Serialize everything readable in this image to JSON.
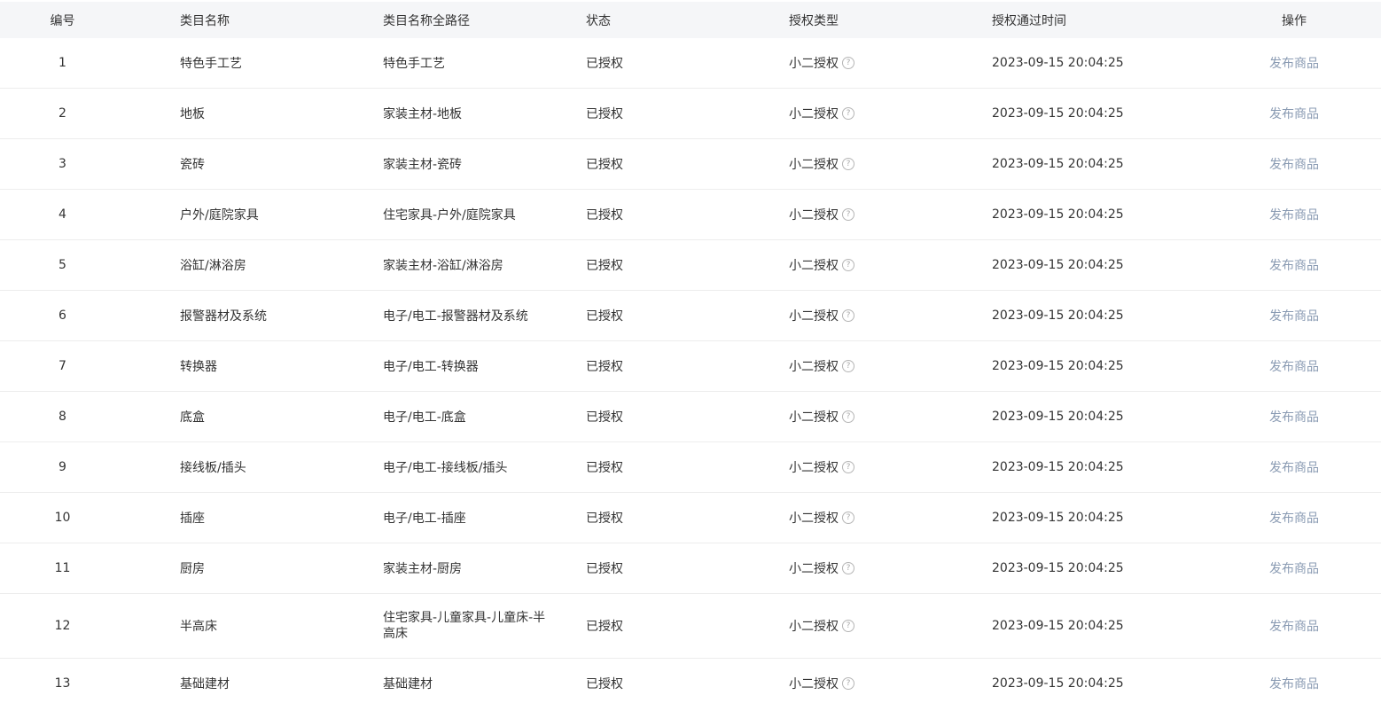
{
  "headers": {
    "id": "编号",
    "name": "类目名称",
    "path": "类目名称全路径",
    "status": "状态",
    "auth_type": "授权类型",
    "auth_time": "授权通过时间",
    "action": "操作"
  },
  "help_icon_glyph": "?",
  "colors": {
    "header_bg": "#f5f6f8",
    "link": "#8a9bb3",
    "divider": "#ededed"
  },
  "rows": [
    {
      "id": "1",
      "name": "特色手工艺",
      "path": "特色手工艺",
      "status": "已授权",
      "auth_type": "小二授权",
      "auth_time": "2023-09-15 20:04:25",
      "action": "发布商品"
    },
    {
      "id": "2",
      "name": "地板",
      "path": "家装主材-地板",
      "status": "已授权",
      "auth_type": "小二授权",
      "auth_time": "2023-09-15 20:04:25",
      "action": "发布商品"
    },
    {
      "id": "3",
      "name": "瓷砖",
      "path": "家装主材-瓷砖",
      "status": "已授权",
      "auth_type": "小二授权",
      "auth_time": "2023-09-15 20:04:25",
      "action": "发布商品"
    },
    {
      "id": "4",
      "name": "户外/庭院家具",
      "path": "住宅家具-户外/庭院家具",
      "status": "已授权",
      "auth_type": "小二授权",
      "auth_time": "2023-09-15 20:04:25",
      "action": "发布商品"
    },
    {
      "id": "5",
      "name": "浴缸/淋浴房",
      "path": "家装主材-浴缸/淋浴房",
      "status": "已授权",
      "auth_type": "小二授权",
      "auth_time": "2023-09-15 20:04:25",
      "action": "发布商品"
    },
    {
      "id": "6",
      "name": "报警器材及系统",
      "path": "电子/电工-报警器材及系统",
      "status": "已授权",
      "auth_type": "小二授权",
      "auth_time": "2023-09-15 20:04:25",
      "action": "发布商品"
    },
    {
      "id": "7",
      "name": "转换器",
      "path": "电子/电工-转换器",
      "status": "已授权",
      "auth_type": "小二授权",
      "auth_time": "2023-09-15 20:04:25",
      "action": "发布商品"
    },
    {
      "id": "8",
      "name": "底盒",
      "path": "电子/电工-底盒",
      "status": "已授权",
      "auth_type": "小二授权",
      "auth_time": "2023-09-15 20:04:25",
      "action": "发布商品"
    },
    {
      "id": "9",
      "name": "接线板/插头",
      "path": "电子/电工-接线板/插头",
      "status": "已授权",
      "auth_type": "小二授权",
      "auth_time": "2023-09-15 20:04:25",
      "action": "发布商品"
    },
    {
      "id": "10",
      "name": "插座",
      "path": "电子/电工-插座",
      "status": "已授权",
      "auth_type": "小二授权",
      "auth_time": "2023-09-15 20:04:25",
      "action": "发布商品"
    },
    {
      "id": "11",
      "name": "厨房",
      "path": "家装主材-厨房",
      "status": "已授权",
      "auth_type": "小二授权",
      "auth_time": "2023-09-15 20:04:25",
      "action": "发布商品"
    },
    {
      "id": "12",
      "name": "半高床",
      "path": "住宅家具-儿童家具-儿童床-半高床",
      "status": "已授权",
      "auth_type": "小二授权",
      "auth_time": "2023-09-15 20:04:25",
      "action": "发布商品"
    },
    {
      "id": "13",
      "name": "基础建材",
      "path": "基础建材",
      "status": "已授权",
      "auth_type": "小二授权",
      "auth_time": "2023-09-15 20:04:25",
      "action": "发布商品"
    }
  ]
}
